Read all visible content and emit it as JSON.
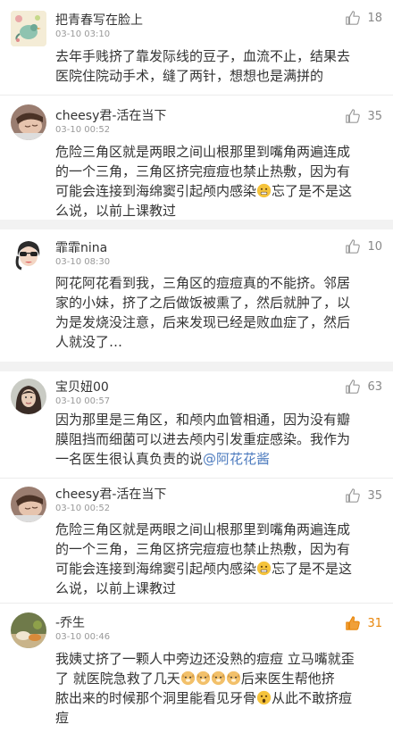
{
  "comments": [
    {
      "user": "把青春写在脸上",
      "time": "03-10 03:10",
      "likes": "18",
      "liked": false,
      "avatar_icon": "bird-illustration-avatar",
      "lines": [
        "去年手贱挤了靠发际线的豆子，血流不止，结果去",
        "医院住院动手术，缝了两针，想想也是满拼的"
      ]
    },
    {
      "user": "cheesy君-活在当下",
      "time": "03-10 00:52",
      "likes": "35",
      "liked": false,
      "avatar_icon": "sleeping-person-avatar",
      "lines": [
        "危险三角区就是两眼之间山根那里到嘴角两遍连成",
        "的一个三角，三角区挤完痘痘也禁止热敷，因为有",
        "可能会连接到海绵窦引起颅内感染",
        "么说，以前上课教过"
      ],
      "line3_tail": "忘了是不是这"
    },
    {
      "user": "霏霏nina",
      "time": "03-10 08:30",
      "likes": "10",
      "liked": false,
      "avatar_icon": "girl-sunglasses-avatar",
      "lines": [
        "阿花阿花看到我，三角区的痘痘真的不能挤。邻居",
        "家的小妹，挤了之后做饭被熏了，然后就肿了，以",
        "为是发烧没注意，后来发现已经是败血症了，然后",
        "人就没了…"
      ]
    },
    {
      "user": "宝贝妞00",
      "time": "03-10 00:57",
      "likes": "63",
      "liked": false,
      "avatar_icon": "woman-photo-avatar",
      "lines": [
        "因为那里是三角区，和颅内血管相通，因为没有瓣",
        "膜阻挡而细菌可以进去颅内引发重症感染。我作为",
        "一名医生很认真负责的说"
      ],
      "mention": "@阿花花酱"
    },
    {
      "user": "cheesy君-活在当下",
      "time": "03-10 00:52",
      "likes": "35",
      "liked": false,
      "avatar_icon": "sleeping-person-avatar",
      "lines": [
        "危险三角区就是两眼之间山根那里到嘴角两遍连成",
        "的一个三角，三角区挤完痘痘也禁止热敷，因为有",
        "可能会连接到海绵窦引起颅内感染",
        "么说，以前上课教过"
      ],
      "line3_tail": "忘了是不是这"
    },
    {
      "user": "-乔生",
      "time": "03-10 00:46",
      "likes": "31",
      "liked": true,
      "avatar_icon": "food-photo-avatar",
      "lines": [
        "我姨丈挤了一颗人中旁边还没熟的痘痘 立马嘴就歪",
        "了 就医院急救了几天",
        "后来医生帮他挤",
        "脓出来的时候那个洞里能看见牙骨",
        "从此不敢挤痘",
        "痘"
      ]
    }
  ],
  "colors": {
    "like_active": "#e8860b",
    "like_inactive": "#999999",
    "mention": "#4e7cbf",
    "separator": "#f2f2f2"
  }
}
